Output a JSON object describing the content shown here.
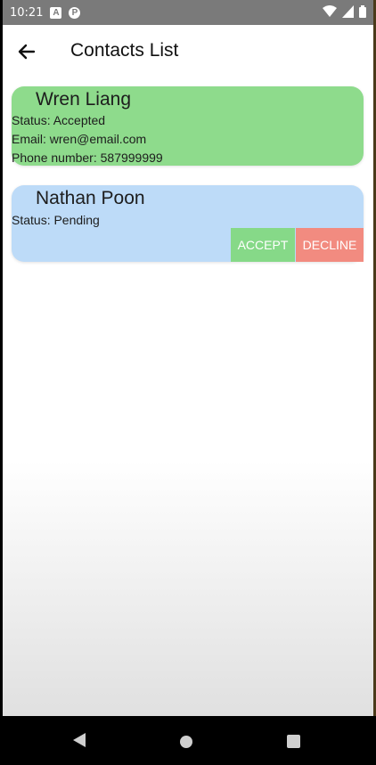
{
  "status_bar": {
    "time": "10:21",
    "icons": [
      "notification-a-icon",
      "notification-pocket-icon",
      "wifi-icon",
      "cell-signal-icon",
      "battery-icon"
    ]
  },
  "app_bar": {
    "back_icon": "arrow-back-icon",
    "title": "Contacts List"
  },
  "contacts": [
    {
      "name": "Wren Liang",
      "status": "Status: Accepted",
      "email": "Email: wren@email.com",
      "phone": "Phone number: 587999999",
      "color": "#8edb8c"
    },
    {
      "name": "Nathan Poon",
      "status": "Status: Pending",
      "color": "#bddbf8",
      "actions": {
        "accept": "ACCEPT",
        "decline": "DECLINE"
      }
    }
  ],
  "nav_bar": {
    "icons": [
      "nav-back-icon",
      "nav-home-icon",
      "nav-recents-icon"
    ]
  }
}
